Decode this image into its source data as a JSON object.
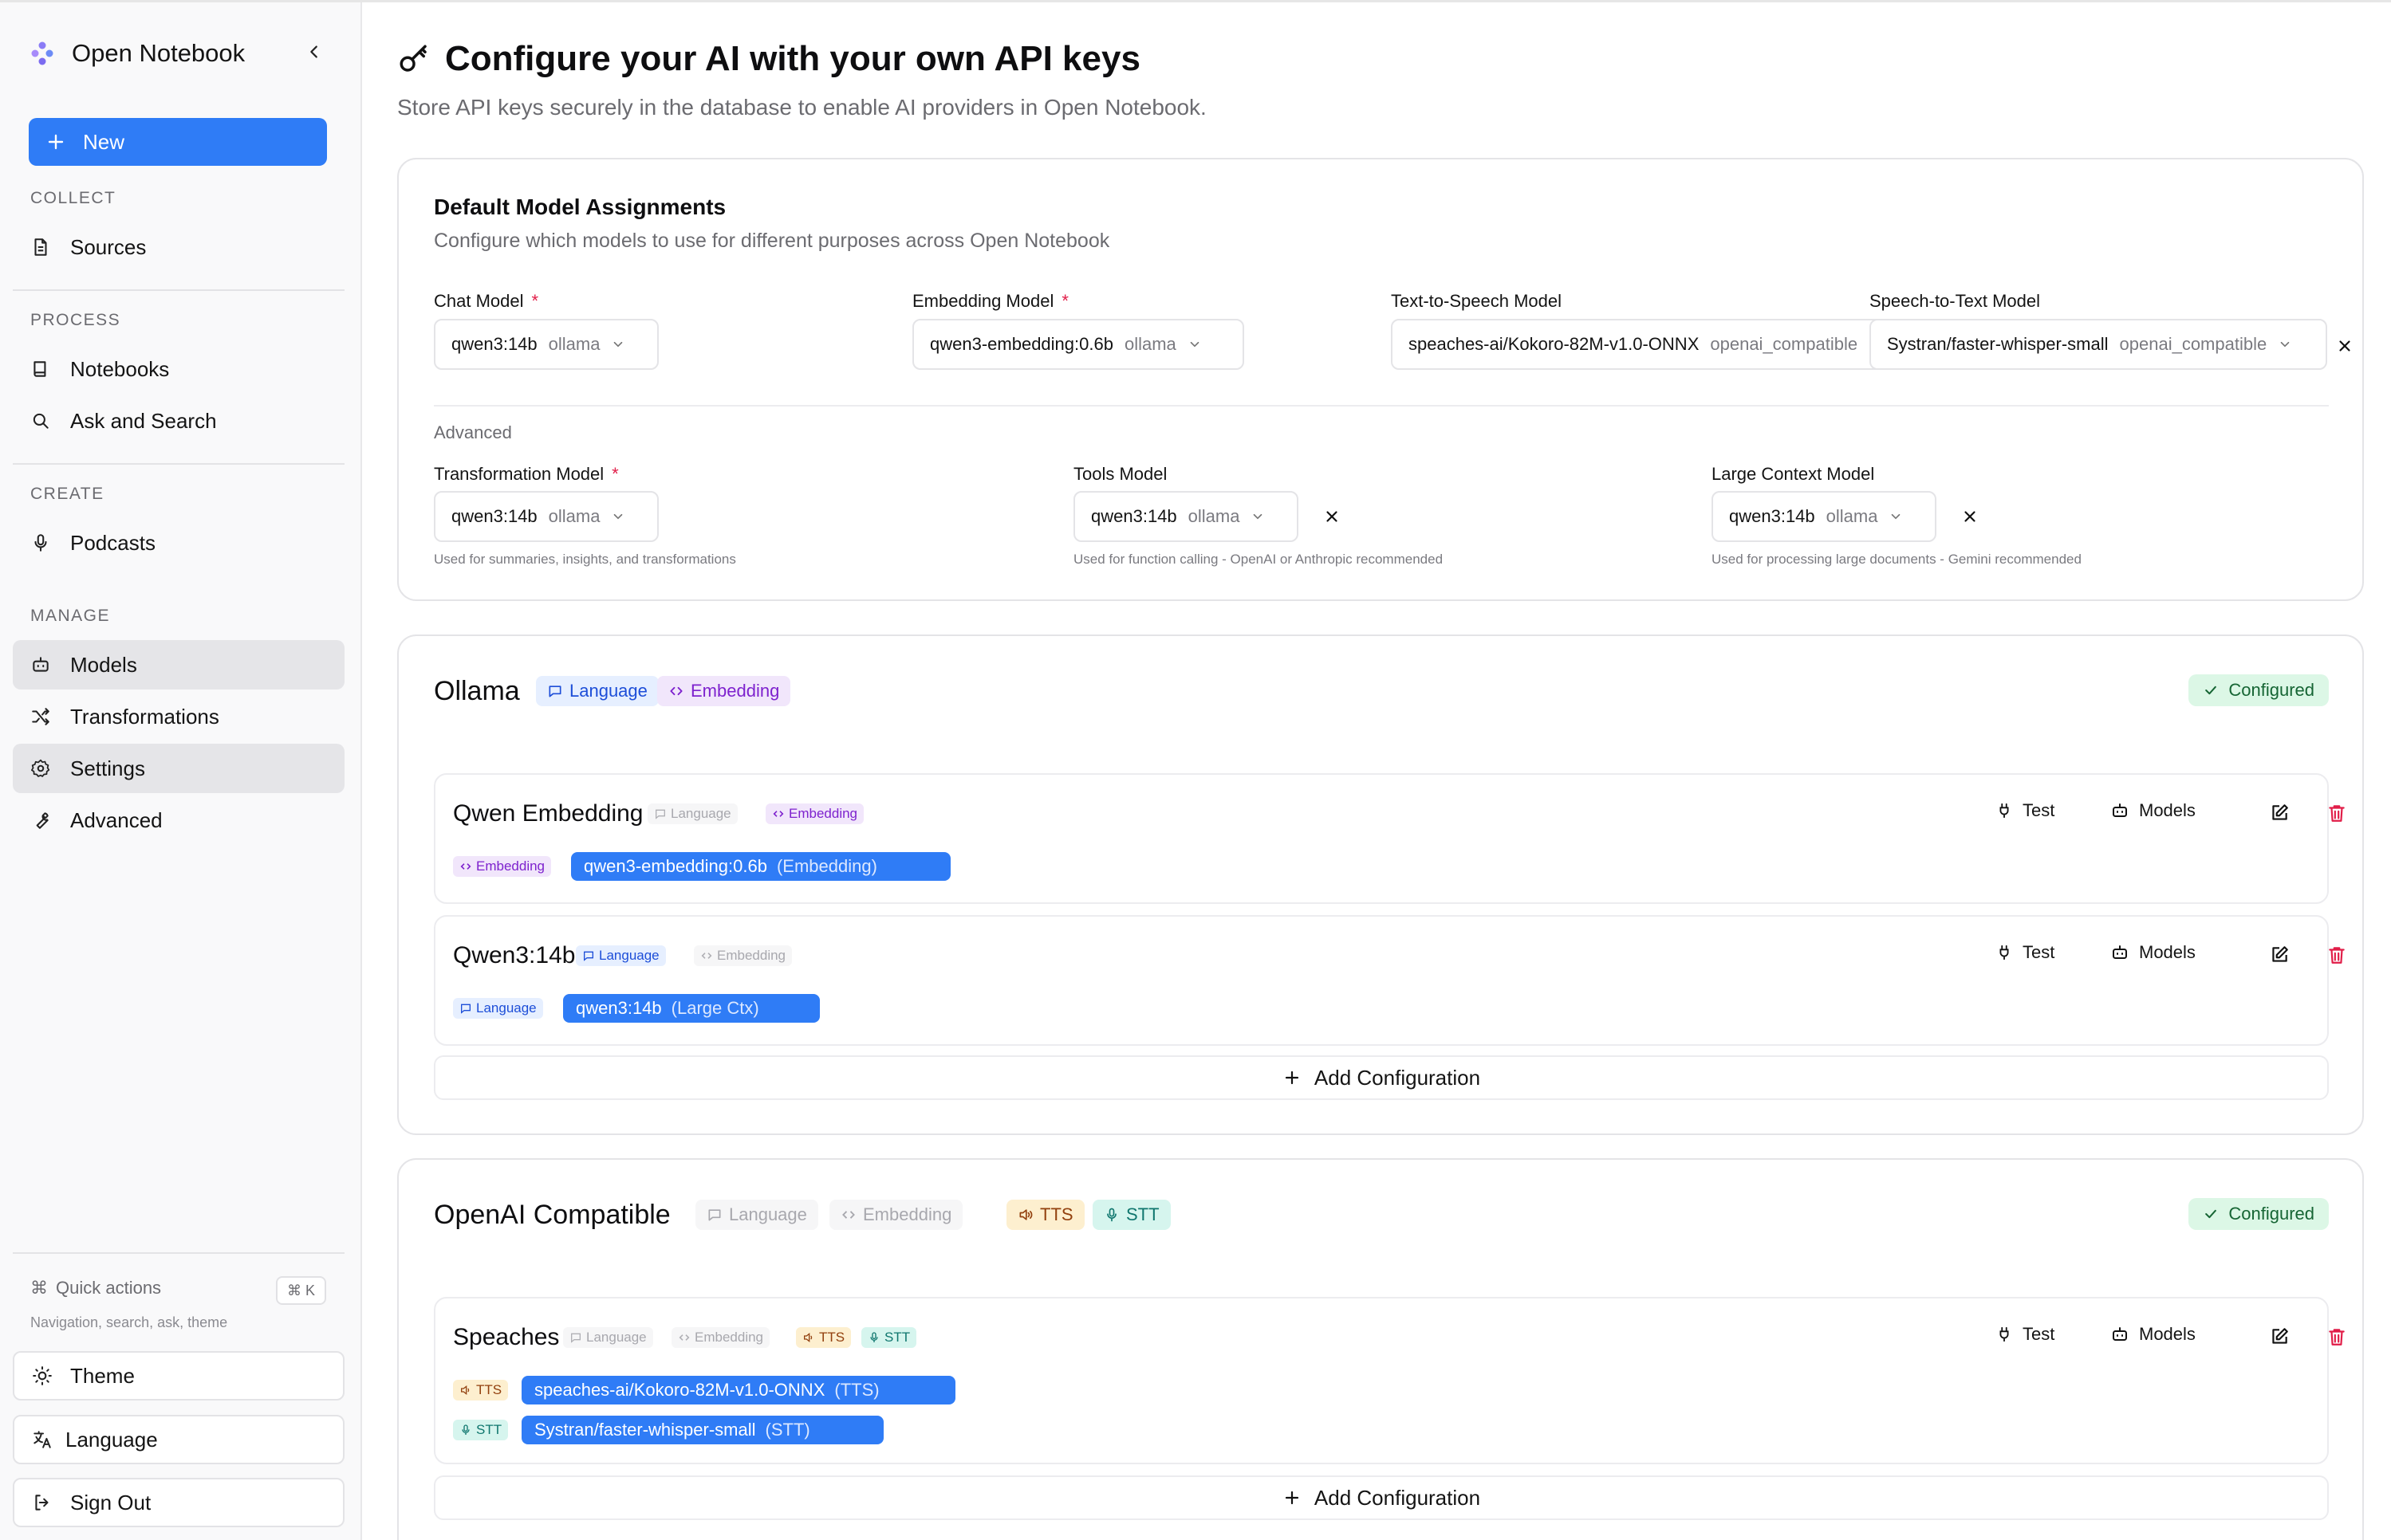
{
  "app": {
    "name": "Open Notebook"
  },
  "sidebar": {
    "new_label": "New",
    "sections": [
      {
        "label": "COLLECT",
        "items": [
          {
            "label": "Sources",
            "icon": "file-text-icon"
          }
        ]
      },
      {
        "label": "PROCESS",
        "items": [
          {
            "label": "Notebooks",
            "icon": "book-icon"
          },
          {
            "label": "Ask and Search",
            "icon": "search-icon"
          }
        ]
      },
      {
        "label": "CREATE",
        "items": [
          {
            "label": "Podcasts",
            "icon": "mic-icon"
          }
        ]
      },
      {
        "label": "MANAGE",
        "items": [
          {
            "label": "Models",
            "icon": "bot-icon",
            "active": true
          },
          {
            "label": "Transformations",
            "icon": "shuffle-icon"
          },
          {
            "label": "Settings",
            "icon": "gear-icon",
            "active": true
          },
          {
            "label": "Advanced",
            "icon": "wrench-icon"
          }
        ]
      }
    ],
    "quick_actions": {
      "label": "Quick actions",
      "shortcut": "⌘ K",
      "sub": "Navigation, search, ask, theme"
    },
    "bottom": {
      "theme": "Theme",
      "language": "Language",
      "sign_out": "Sign Out"
    }
  },
  "page": {
    "title": "Configure your AI with your own API keys",
    "subtitle": "Store API keys securely in the database to enable AI providers in Open Notebook."
  },
  "defaults": {
    "title": "Default Model Assignments",
    "desc": "Configure which models to use for different purposes across Open Notebook",
    "chat": {
      "label": "Chat Model",
      "model": "qwen3:14b",
      "provider": "ollama"
    },
    "embedding": {
      "label": "Embedding Model",
      "model": "qwen3-embedding:0.6b",
      "provider": "ollama"
    },
    "tts": {
      "label": "Text-to-Speech Model",
      "model": "speaches-ai/Kokoro-82M-v1.0-ONNX",
      "provider": "openai_compatible"
    },
    "stt": {
      "label": "Speech-to-Text Model",
      "model": "Systran/faster-whisper-small",
      "provider": "openai_compatible"
    },
    "advanced_label": "Advanced",
    "transformation": {
      "label": "Transformation Model",
      "model": "qwen3:14b",
      "provider": "ollama",
      "hint": "Used for summaries, insights, and transformations"
    },
    "tools": {
      "label": "Tools Model",
      "model": "qwen3:14b",
      "provider": "ollama",
      "hint": "Used for function calling - OpenAI or Anthropic recommended"
    },
    "large_context": {
      "label": "Large Context Model",
      "model": "qwen3:14b",
      "provider": "ollama",
      "hint": "Used for processing large documents - Gemini recommended"
    }
  },
  "capabilities": {
    "language": "Language",
    "embedding": "Embedding",
    "tts": "TTS",
    "stt": "STT"
  },
  "status": {
    "configured": "Configured"
  },
  "actions": {
    "test": "Test",
    "models": "Models",
    "add_configuration": "Add Configuration"
  },
  "providers": [
    {
      "name": "Ollama",
      "configs": [
        {
          "name": "Qwen Embedding",
          "models": [
            {
              "cap": "Embedding",
              "name": "qwen3-embedding:0.6b",
              "kind": "(Embedding)"
            }
          ]
        },
        {
          "name": "Qwen3:14b",
          "models": [
            {
              "cap": "Language",
              "name": "qwen3:14b",
              "kind": "(Large Ctx)"
            }
          ]
        }
      ]
    },
    {
      "name": "OpenAI Compatible",
      "configs": [
        {
          "name": "Speaches",
          "models": [
            {
              "cap": "TTS",
              "name": "speaches-ai/Kokoro-82M-v1.0-ONNX",
              "kind": "(TTS)"
            },
            {
              "cap": "STT",
              "name": "Systran/faster-whisper-small",
              "kind": "(STT)"
            }
          ]
        }
      ]
    }
  ],
  "colors": {
    "accent": "#2f7cf6",
    "danger": "#e11d48",
    "configured_bg": "#dcf7e6",
    "configured_fg": "#166534"
  }
}
